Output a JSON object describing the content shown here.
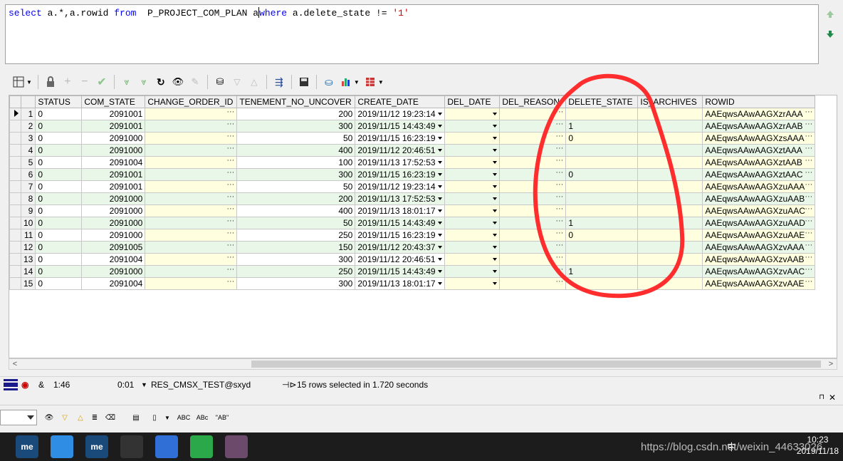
{
  "editor": {
    "sql_parts": [
      {
        "text": "select",
        "cls": "kw"
      },
      {
        "text": " a.*,a.rowid ",
        "cls": ""
      },
      {
        "text": "from",
        "cls": "kw"
      },
      {
        "text": "  P_PROJECT_COM_PLAN a",
        "cls": ""
      },
      {
        "text": "caret",
        "cls": "caret"
      },
      {
        "text": "where",
        "cls": "kw"
      },
      {
        "text": " a.delete_state != ",
        "cls": ""
      },
      {
        "text": "'1'",
        "cls": "str"
      }
    ]
  },
  "grid": {
    "columns": [
      "STATUS",
      "COM_STATE",
      "CHANGE_ORDER_ID",
      "TENEMENT_NO_UNCOVER",
      "CREATE_DATE",
      "DEL_DATE",
      "DEL_REASON",
      "DELETE_STATE",
      "IS_ARCHIVES",
      "ROWID"
    ],
    "rows": [
      {
        "n": "1",
        "status": "0",
        "com_state": "2091001",
        "tenement": "200",
        "create_date": "2019/11/12 19:23:14",
        "delete_state": "",
        "rowid": "AAEqwsAAwAAGXzrAAA"
      },
      {
        "n": "2",
        "status": "0",
        "com_state": "2091001",
        "tenement": "300",
        "create_date": "2019/11/15 14:43:49",
        "delete_state": "1",
        "rowid": "AAEqwsAAwAAGXzrAAB"
      },
      {
        "n": "3",
        "status": "0",
        "com_state": "2091000",
        "tenement": "50",
        "create_date": "2019/11/15 16:23:19",
        "delete_state": "0",
        "rowid": "AAEqwsAAwAAGXzsAAA"
      },
      {
        "n": "4",
        "status": "0",
        "com_state": "2091000",
        "tenement": "400",
        "create_date": "2019/11/12 20:46:51",
        "delete_state": "",
        "rowid": "AAEqwsAAwAAGXztAAA"
      },
      {
        "n": "5",
        "status": "0",
        "com_state": "2091004",
        "tenement": "100",
        "create_date": "2019/11/13 17:52:53",
        "delete_state": "",
        "rowid": "AAEqwsAAwAAGXztAAB"
      },
      {
        "n": "6",
        "status": "0",
        "com_state": "2091001",
        "tenement": "300",
        "create_date": "2019/11/15 16:23:19",
        "delete_state": "0",
        "rowid": "AAEqwsAAwAAGXztAAC"
      },
      {
        "n": "7",
        "status": "0",
        "com_state": "2091001",
        "tenement": "50",
        "create_date": "2019/11/12 19:23:14",
        "delete_state": "",
        "rowid": "AAEqwsAAwAAGXzuAAA"
      },
      {
        "n": "8",
        "status": "0",
        "com_state": "2091000",
        "tenement": "200",
        "create_date": "2019/11/13 17:52:53",
        "delete_state": "",
        "rowid": "AAEqwsAAwAAGXzuAAB"
      },
      {
        "n": "9",
        "status": "0",
        "com_state": "2091000",
        "tenement": "400",
        "create_date": "2019/11/13 18:01:17",
        "delete_state": "",
        "rowid": "AAEqwsAAwAAGXzuAAC"
      },
      {
        "n": "10",
        "status": "0",
        "com_state": "2091000",
        "tenement": "50",
        "create_date": "2019/11/15 14:43:49",
        "delete_state": "1",
        "rowid": "AAEqwsAAwAAGXzuAAD"
      },
      {
        "n": "11",
        "status": "0",
        "com_state": "2091000",
        "tenement": "250",
        "create_date": "2019/11/15 16:23:19",
        "delete_state": "0",
        "rowid": "AAEqwsAAwAAGXzuAAE"
      },
      {
        "n": "12",
        "status": "0",
        "com_state": "2091005",
        "tenement": "150",
        "create_date": "2019/11/12 20:43:37",
        "delete_state": "",
        "rowid": "AAEqwsAAwAAGXzvAAA"
      },
      {
        "n": "13",
        "status": "0",
        "com_state": "2091004",
        "tenement": "300",
        "create_date": "2019/11/12 20:46:51",
        "delete_state": "",
        "rowid": "AAEqwsAAwAAGXzvAAB"
      },
      {
        "n": "14",
        "status": "0",
        "com_state": "2091000",
        "tenement": "250",
        "create_date": "2019/11/15 14:43:49",
        "delete_state": "1",
        "rowid": "AAEqwsAAwAAGXzvAAC"
      },
      {
        "n": "15",
        "status": "0",
        "com_state": "2091004",
        "tenement": "300",
        "create_date": "2019/11/13 18:01:17",
        "delete_state": "",
        "rowid": "AAEqwsAAwAAGXzvAAE"
      }
    ],
    "ellipsis": "···"
  },
  "statusbar": {
    "ampersand": "&",
    "position": "1:46",
    "elapsed": "0:01",
    "connection": "RES_CMSX_TEST@sxyd",
    "message": "15 rows selected in 1.720 seconds"
  },
  "findbar": {
    "abc_label": "ABC",
    "abc2_label": "ABc",
    "quoted_label": "\"AB\""
  },
  "taskbar": {
    "icons": [
      {
        "label": "me",
        "color": "#1a4a7a"
      },
      {
        "label": "",
        "color": "#2f8de4"
      },
      {
        "label": "me",
        "color": "#1a4a7a"
      },
      {
        "label": "",
        "color": "#333333"
      },
      {
        "label": "",
        "color": "#2f6fd6"
      },
      {
        "label": "",
        "color": "#2aa84a"
      },
      {
        "label": "",
        "color": "#6b4a6b"
      }
    ],
    "time": "10:23",
    "date": "2019/11/18",
    "ime": "中",
    "watermark": "https://blog.csdn.net/weixin_44633026"
  },
  "colors": {
    "accent_red": "#ff2d2d",
    "keyword_blue": "#0000ff",
    "row_alt_green": "#e8f7e8",
    "cell_yellow": "#ffffe0"
  }
}
